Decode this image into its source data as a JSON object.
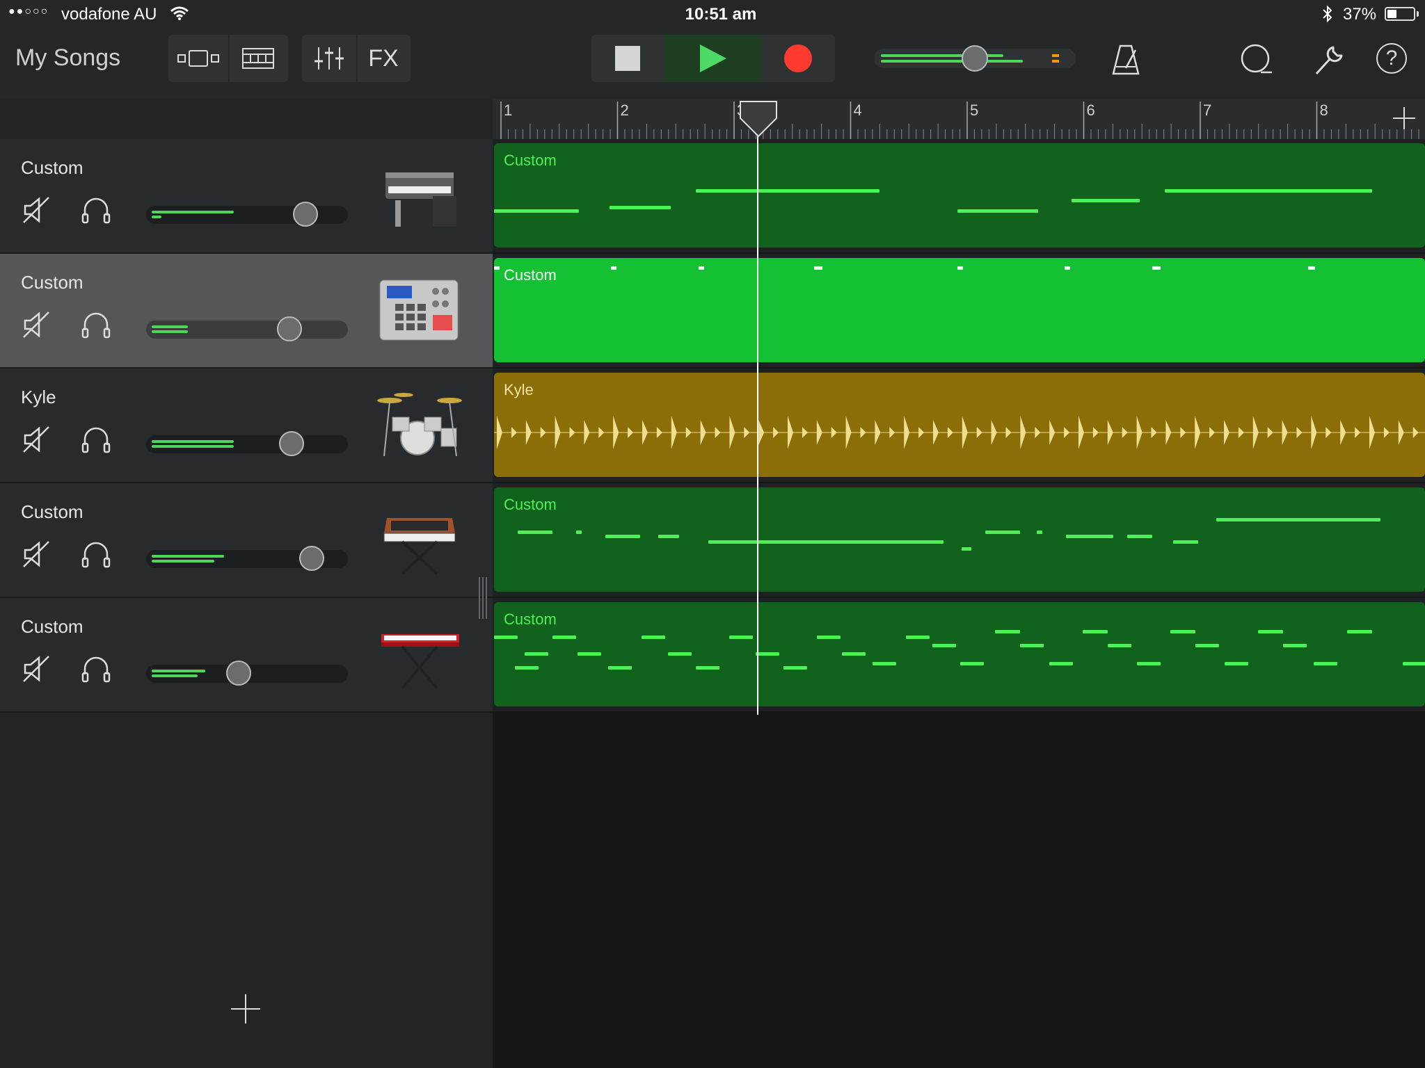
{
  "status_bar": {
    "signal": "●●○○○",
    "carrier": "vodafone AU",
    "time": "10:51 am",
    "battery_percent": "37%",
    "battery_level": 0.37
  },
  "toolbar": {
    "my_songs": "My Songs",
    "fx_label": "FX",
    "master_volume": 0.5
  },
  "colors": {
    "accent_green": "#4cf255",
    "region_green_dark": "#10621c",
    "region_green_bright": "#14c133",
    "region_audio": "#8c6e09",
    "record_red": "#ff3b30"
  },
  "ruler": {
    "bars": [
      "1",
      "2",
      "3",
      "4",
      "5",
      "6",
      "7",
      "8"
    ]
  },
  "tracks": [
    {
      "name": "Custom",
      "instrument": "electric-piano-icon",
      "volume": 0.79,
      "meter": [
        0.43,
        0.05
      ]
    },
    {
      "name": "Custom",
      "instrument": "drum-machine-icon",
      "volume": 0.71,
      "meter": [
        0.19,
        0.19
      ]
    },
    {
      "name": "Kyle",
      "instrument": "drum-kit-icon",
      "volume": 0.72,
      "meter": [
        0.43,
        0.43
      ]
    },
    {
      "name": "Custom",
      "instrument": "analog-synth-icon",
      "volume": 0.82,
      "meter": [
        0.38,
        0.33
      ]
    },
    {
      "name": "Custom",
      "instrument": "red-keyboard-icon",
      "volume": 0.46,
      "meter": [
        0.28,
        0.24
      ]
    }
  ],
  "regions": [
    {
      "label": "Custom"
    },
    {
      "label": "Custom"
    },
    {
      "label": "Kyle"
    },
    {
      "label": "Custom"
    },
    {
      "label": "Custom"
    }
  ]
}
